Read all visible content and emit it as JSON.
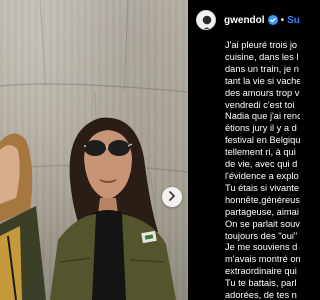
{
  "post": {
    "username": "gwendol",
    "follow_label": "Sui",
    "separator": "•",
    "caption_lines": [
      "J'ai pleuré trois jo",
      "cuisine, dans les l",
      "dans un train, je n",
      "tant la vie si vache",
      "des amours trop v",
      "vendredi c'est toi",
      "Nadia que j'ai renc",
      "étions jury il y a d",
      "festival en Belgiqu",
      "tellement ri, à qui",
      "de vie, avec qui d",
      "l'évidence a explo",
      "Tu étais si vivante",
      "honnête,généreus",
      "partageuse, aimai",
      "On se parlait souv",
      "toujours des \"oui\"",
      "Je me souviens d",
      "m'avais montré on",
      "extraordinaire qui",
      "Tu te battais, parl",
      "adorées, de tes n"
    ]
  },
  "icons": {
    "verified": "verified-badge-icon",
    "next": "chevron-right-icon",
    "avatar": "profile-avatar"
  },
  "colors": {
    "panel_bg": "#000000",
    "follow": "#3b82f6",
    "verified": "#3897f0"
  }
}
